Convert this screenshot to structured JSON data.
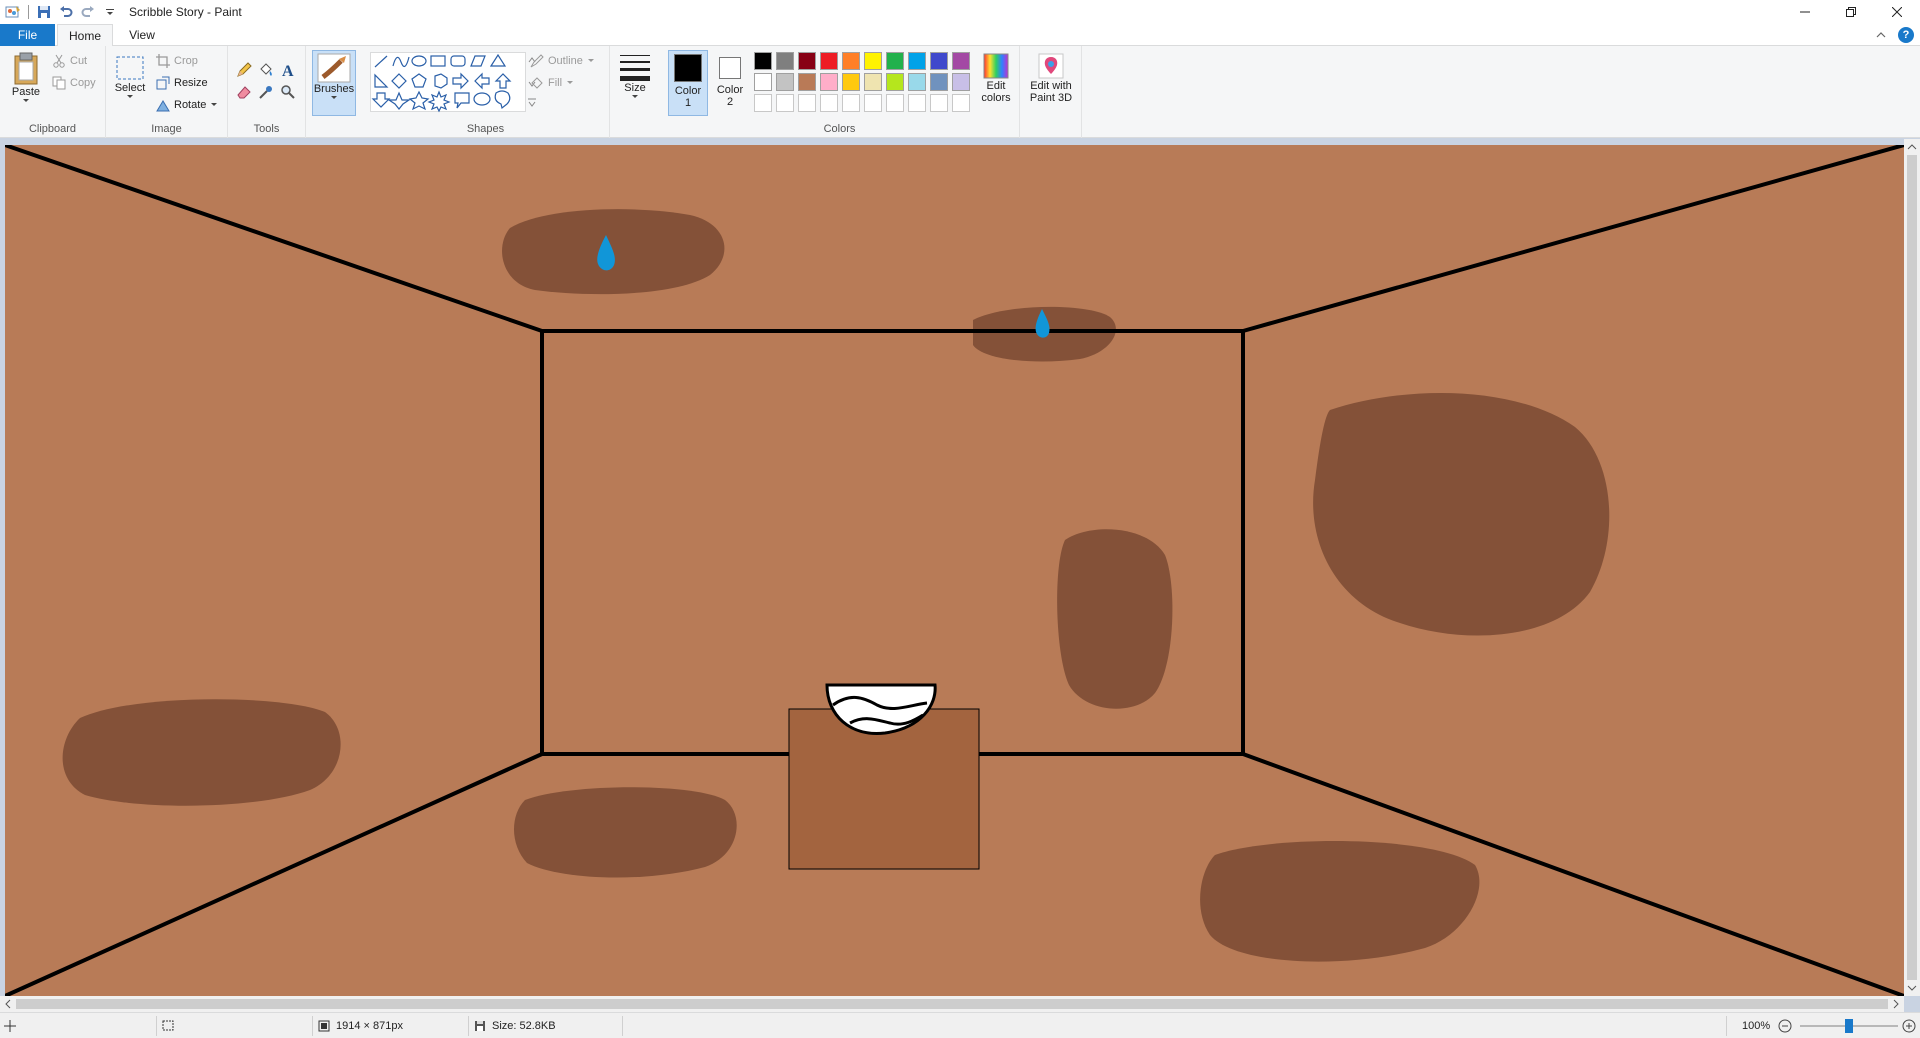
{
  "window": {
    "title": "Scribble Story - Paint"
  },
  "menu": {
    "file": "File",
    "home": "Home",
    "view": "View"
  },
  "ribbon": {
    "clipboard": {
      "label": "Clipboard",
      "paste": "Paste",
      "cut": "Cut",
      "copy": "Copy"
    },
    "image": {
      "label": "Image",
      "select": "Select",
      "crop": "Crop",
      "resize": "Resize",
      "rotate": "Rotate"
    },
    "tools": {
      "label": "Tools"
    },
    "brushes": {
      "label": "Brushes"
    },
    "shapes": {
      "label": "Shapes",
      "outline": "Outline",
      "fill": "Fill"
    },
    "size": {
      "label": "Size"
    },
    "colors": {
      "label": "Colors",
      "color1_line1": "Color",
      "color1_line2": "1",
      "color2_line1": "Color",
      "color2_line2": "2",
      "edit_line1": "Edit",
      "edit_line2": "colors",
      "paint3d_line1": "Edit with",
      "paint3d_line2": "Paint 3D",
      "color1_value": "#000000",
      "color2_value": "#ffffff",
      "palette_row1": [
        "#000000",
        "#7f7f7f",
        "#880015",
        "#ed1c24",
        "#ff7f27",
        "#fff200",
        "#22b14c",
        "#00a2e8",
        "#3f48cc",
        "#a349a4"
      ],
      "palette_row2": [
        "#ffffff",
        "#c3c3c3",
        "#b97a57",
        "#ffaec9",
        "#ffc90e",
        "#efe4b0",
        "#b5e61d",
        "#99d9ea",
        "#7092be",
        "#c8bfe7"
      ]
    }
  },
  "drawing": {
    "background": "#b87b57",
    "stain_color": "#7a4a32",
    "box_color": "#a3643f",
    "drop_color": "#1196d8"
  },
  "status": {
    "dimensions": "1914 × 871px",
    "size": "Size: 52.8KB",
    "zoom": "100%",
    "zoom_level": 1.0
  }
}
